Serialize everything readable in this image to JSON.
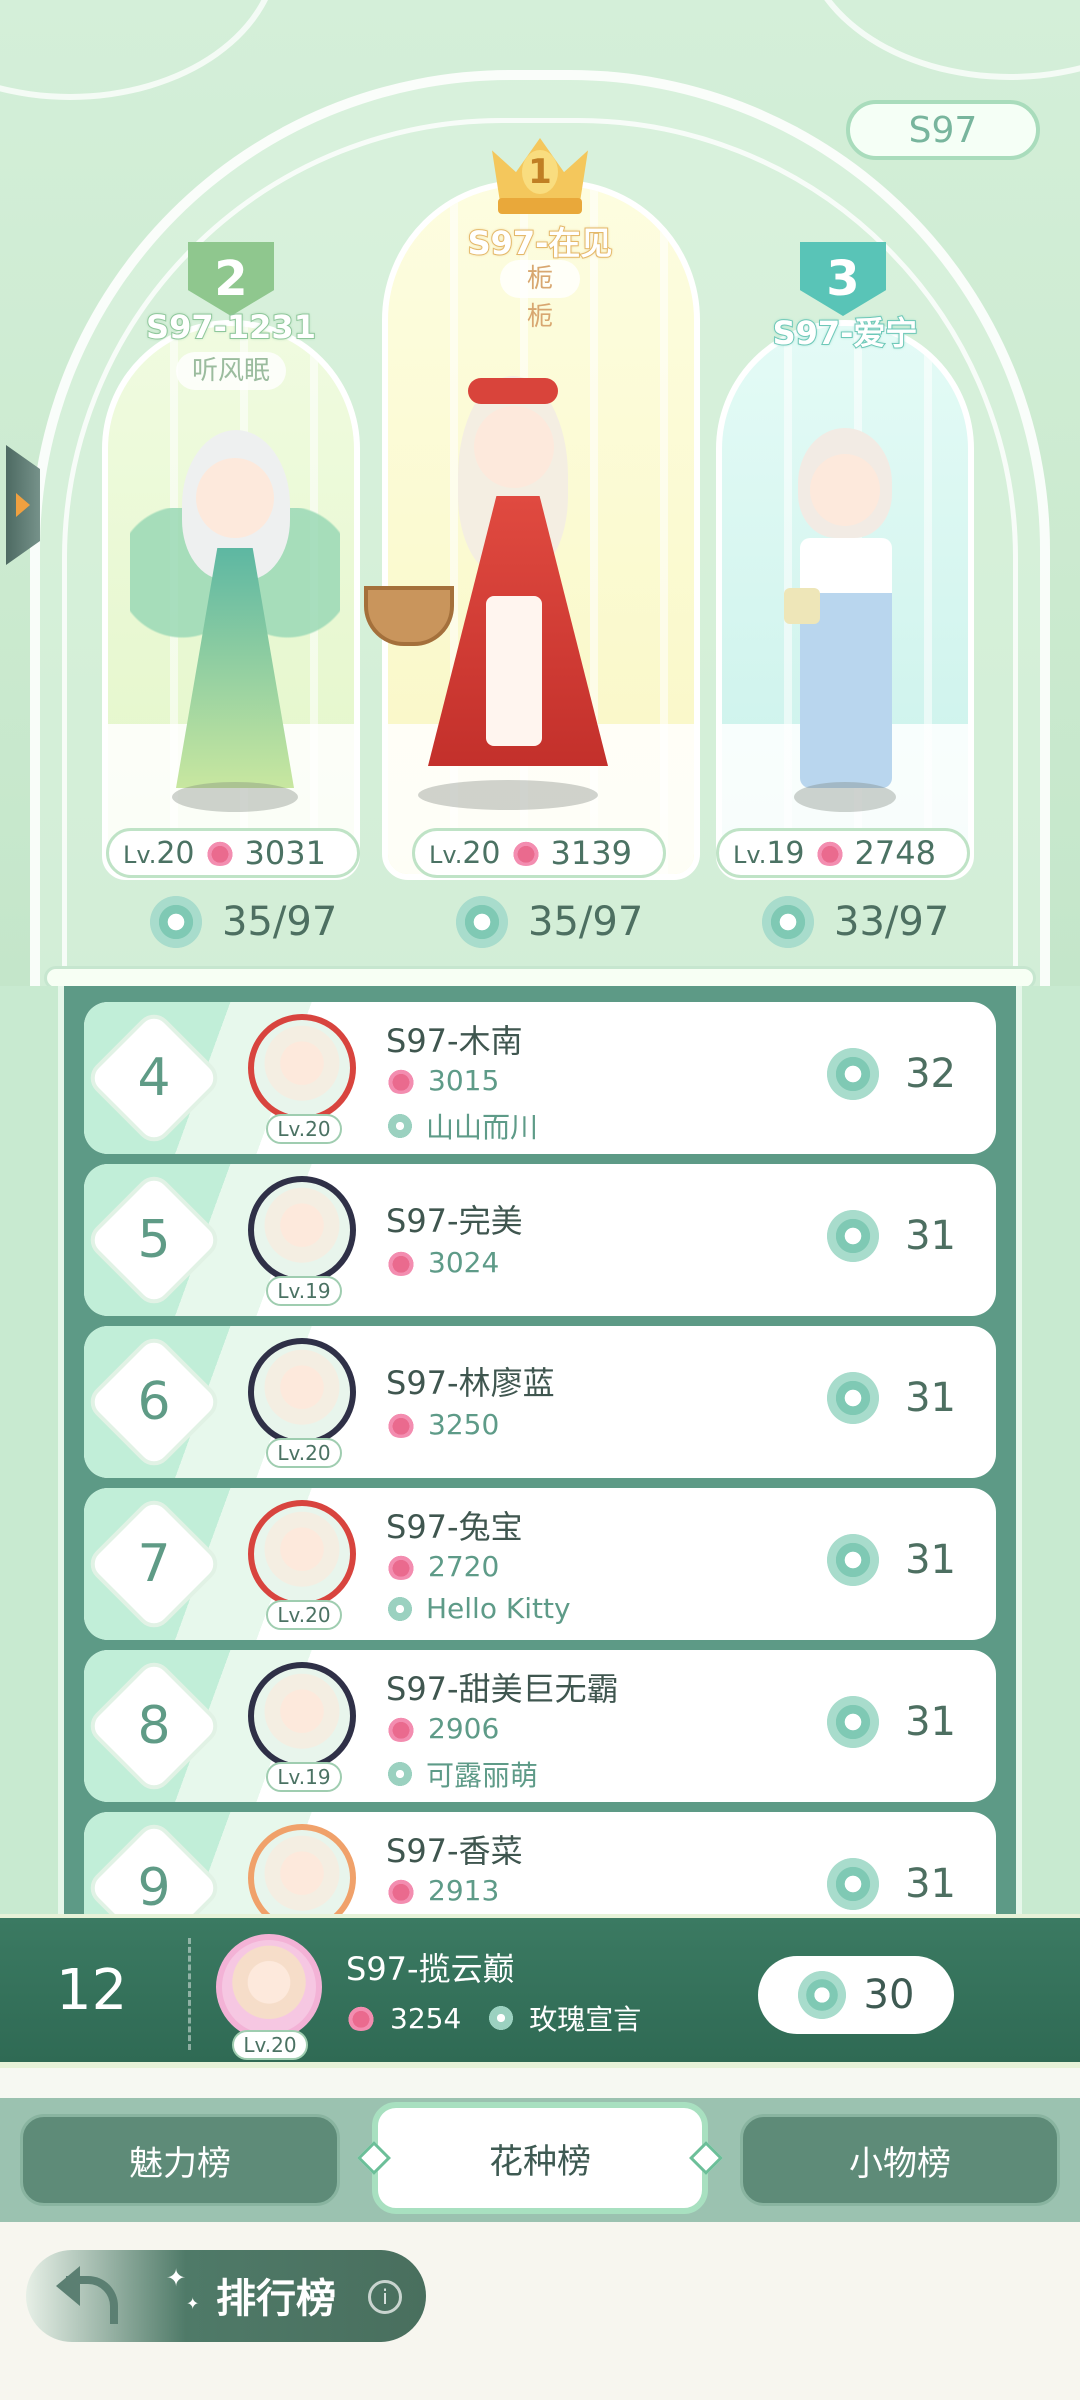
{
  "season_badge": "S97",
  "podium": [
    {
      "rank": "1",
      "name": "S97-在见",
      "tag": "栀栀",
      "level_prefix": "Lv.",
      "level": "20",
      "charm": "3139",
      "flowers": "35/97"
    },
    {
      "rank": "2",
      "name": "S97-1231",
      "tag": "听风眠",
      "level_prefix": "Lv.",
      "level": "20",
      "charm": "3031",
      "flowers": "35/97"
    },
    {
      "rank": "3",
      "name": "S97-爱宁",
      "tag": "",
      "level_prefix": "Lv.",
      "level": "19",
      "charm": "2748",
      "flowers": "33/97"
    }
  ],
  "rows": [
    {
      "rank": "4",
      "name": "S97-木南",
      "charm": "3015",
      "guild": "山山而川",
      "level": "Lv.20",
      "score": "32"
    },
    {
      "rank": "5",
      "name": "S97-完美",
      "charm": "3024",
      "guild": "",
      "level": "Lv.19",
      "score": "31"
    },
    {
      "rank": "6",
      "name": "S97-林廖蓝",
      "charm": "3250",
      "guild": "",
      "level": "Lv.20",
      "score": "31"
    },
    {
      "rank": "7",
      "name": "S97-兔宝",
      "charm": "2720",
      "guild": "Hello Kitty",
      "level": "Lv.20",
      "score": "31"
    },
    {
      "rank": "8",
      "name": "S97-甜美巨无霸",
      "charm": "2906",
      "guild": "可露丽萌",
      "level": "Lv.19",
      "score": "31"
    },
    {
      "rank": "9",
      "name": "S97-香菜",
      "charm": "2913",
      "guild": "",
      "level": "",
      "score": "31"
    }
  ],
  "me": {
    "rank": "12",
    "name": "S97-揽云巅",
    "charm": "3254",
    "guild": "玫瑰宣言",
    "level": "Lv.20",
    "score": "30"
  },
  "tabs": {
    "charm": "魅力榜",
    "flower": "花种榜",
    "item": "小物榜"
  },
  "footer": {
    "title": "排行榜",
    "info": "i"
  },
  "icons": {
    "charm": "rose-icon",
    "score": "flower-icon",
    "guild": "guild-icon",
    "back": "back-arrow-icon",
    "crown": "crown-icon"
  },
  "colors": {
    "accent": "#3b7a62",
    "rank1": "#f4c75c",
    "rank2": "#8fc78e",
    "rank3": "#59c4b7"
  }
}
